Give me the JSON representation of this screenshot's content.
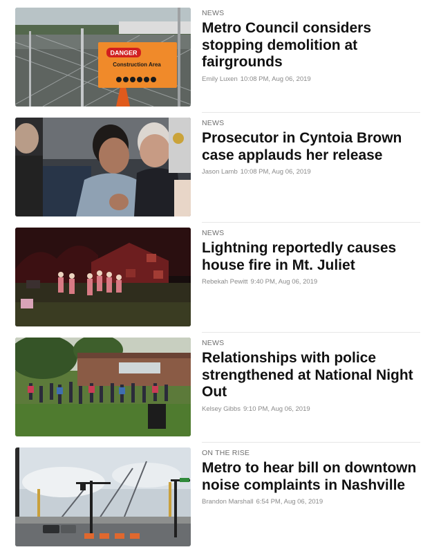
{
  "stories": [
    {
      "section": "NEWS",
      "headline": "Metro Council considers stopping demolition at fairgrounds",
      "author": "Emily Luxen",
      "timestamp": "10:08 PM, Aug 06, 2019",
      "image": {
        "description": "Construction fence with danger sign",
        "sign_title": "DANGER",
        "sign_subtitle": "Construction Area"
      }
    },
    {
      "section": "NEWS",
      "headline": "Prosecutor in Cyntoia Brown case applauds her release",
      "author": "Jason Lamb",
      "timestamp": "10:08 PM, Aug 06, 2019",
      "image": {
        "description": "Courtroom scene"
      }
    },
    {
      "section": "NEWS",
      "headline": "Lightning reportedly causes house fire in Mt. Juliet",
      "author": "Rebekah Pewitt",
      "timestamp": "9:40 PM, Aug 06, 2019",
      "image": {
        "description": "Night scene of house fire with crowd"
      }
    },
    {
      "section": "NEWS",
      "headline": "Relationships with police strengthened at National Night Out",
      "author": "Kelsey Gibbs",
      "timestamp": "9:10 PM, Aug 06, 2019",
      "image": {
        "description": "Crowd gathered outside community building"
      }
    },
    {
      "section": "ON THE RISE",
      "headline": "Metro to hear bill on downtown noise complaints in Nashville",
      "author": "Brandon Marshall",
      "timestamp": "6:54 PM, Aug 06, 2019",
      "image": {
        "description": "Downtown construction cranes"
      }
    }
  ],
  "colors": {
    "headline": "#111111",
    "section": "#6e6e6e",
    "byline": "#8a8a8a",
    "divider": "#e6e6e6"
  }
}
